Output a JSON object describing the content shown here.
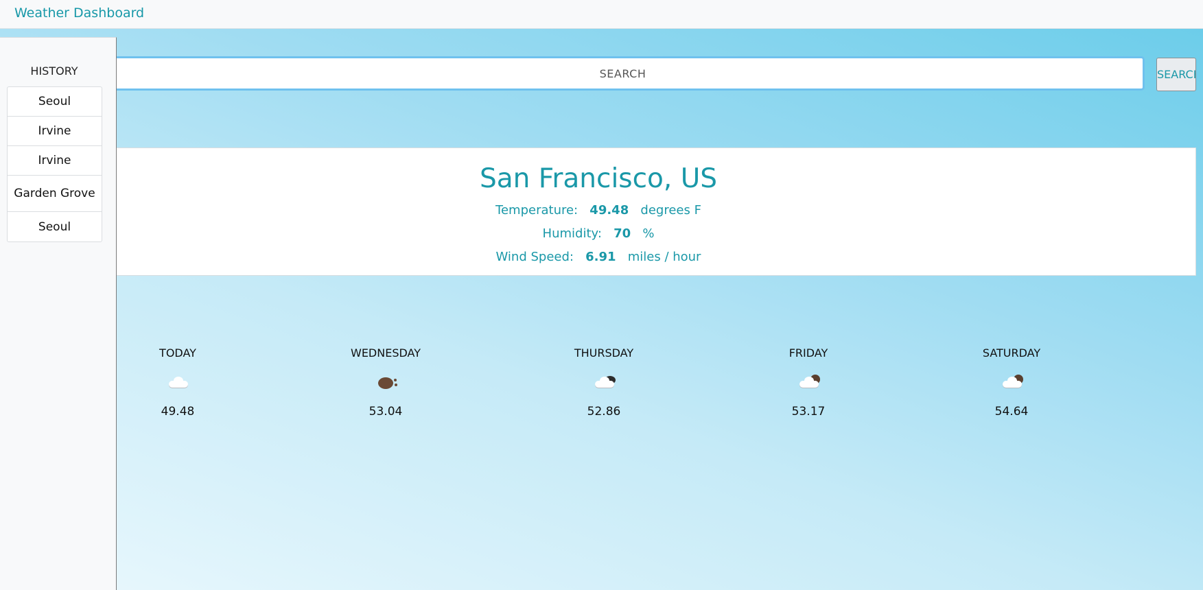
{
  "app": {
    "title": "Weather Dashboard"
  },
  "search": {
    "placeholder": "SEARCH",
    "button_label": "SEARCH"
  },
  "sidebar": {
    "title": "HISTORY",
    "items": [
      {
        "label": "Seoul"
      },
      {
        "label": "Irvine"
      },
      {
        "label": "Irvine"
      },
      {
        "label": "Garden Grove"
      },
      {
        "label": "Seoul"
      }
    ]
  },
  "current": {
    "city": "San Francisco, US",
    "temperature": {
      "label": "Temperature:",
      "value": "49.48",
      "unit": "degrees F"
    },
    "humidity": {
      "label": "Humidity:",
      "value": "70",
      "unit": "%"
    },
    "wind": {
      "label": "Wind Speed:",
      "value": "6.91",
      "unit": "miles / hour"
    }
  },
  "forecast": [
    {
      "day": "TODAY",
      "icon": "cloud-icon",
      "temp": "49.48"
    },
    {
      "day": "WEDNESDAY",
      "icon": "rain-icon",
      "temp": "53.04"
    },
    {
      "day": "THURSDAY",
      "icon": "dark-cloud-icon",
      "temp": "52.86"
    },
    {
      "day": "FRIDAY",
      "icon": "partly-cloudy-icon",
      "temp": "53.17"
    },
    {
      "day": "SATURDAY",
      "icon": "partly-cloudy-icon",
      "temp": "54.64"
    }
  ],
  "colors": {
    "accent": "#1a98a8",
    "sky": "#6ccdea"
  }
}
